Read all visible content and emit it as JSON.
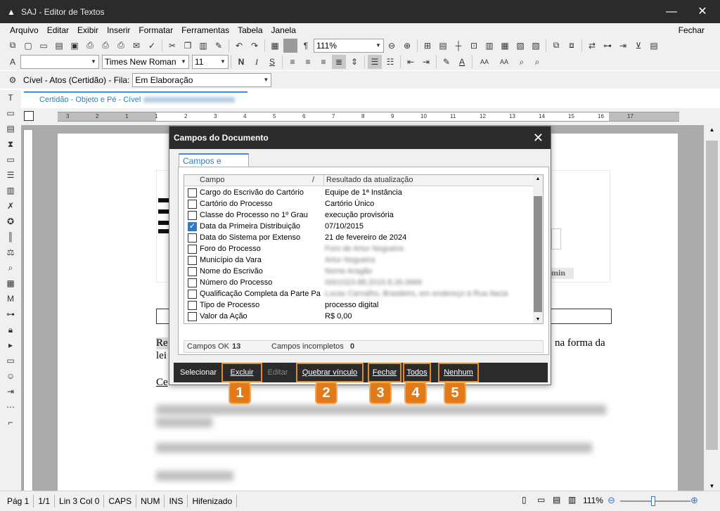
{
  "window": {
    "title": "SAJ - Editor de Textos",
    "minimize": "—",
    "close": "✕"
  },
  "menu": {
    "items": [
      "Arquivo",
      "Editar",
      "Exibir",
      "Inserir",
      "Formatar",
      "Ferramentas",
      "Tabela",
      "Janela"
    ],
    "fechar": "Fechar"
  },
  "toolbar1": {
    "zoom": "111%"
  },
  "toolbar2": {
    "font": "Times New Roman",
    "size": "11",
    "bold": "N",
    "italic": "I",
    "strike": "S",
    "fontsizeA1": "AA",
    "fontsizeA2": "AA"
  },
  "filter_bar": {
    "label": "Cível - Atos (Certidão) - Fila:",
    "value": "Em Elaboração"
  },
  "document_tab": {
    "label": "Certidão - Objeto e Pé - Cível"
  },
  "ruler": {
    "numbers": [
      "3",
      "2",
      "1",
      "1",
      "2",
      "3",
      "4",
      "5",
      "6",
      "7",
      "8",
      "9",
      "10",
      "11",
      "12",
      "13",
      "14",
      "15",
      "16",
      "17"
    ]
  },
  "page": {
    "text1": "Re",
    "text2": "lei",
    "text3": "Ce",
    "text4": "na forma da",
    "stamp": "min"
  },
  "dialog": {
    "title": "Campos do Documento",
    "tab": "Campos e valores",
    "headers": {
      "campo": "Campo",
      "sort": "/",
      "resultado": "Resultado da atualização"
    },
    "rows": [
      {
        "campo": "Cargo do Escrivão do Cartório",
        "valor": "Equipe de 1ª Instância",
        "checked": false,
        "blurred": false
      },
      {
        "campo": "Cartório do Processo",
        "valor": "Cartório Único",
        "checked": false,
        "blurred": false
      },
      {
        "campo": "Classe do Processo no 1º Grau",
        "valor": "execução provisória",
        "checked": false,
        "blurred": false
      },
      {
        "campo": "Data da Primeira Distribuição",
        "valor": "07/10/2015",
        "checked": true,
        "blurred": false
      },
      {
        "campo": "Data do Sistema por Extenso",
        "valor": "21 de fevereiro de 2024",
        "checked": false,
        "blurred": false
      },
      {
        "campo": "Foro do Processo",
        "valor": "Foro de Artur Nogueira",
        "checked": false,
        "blurred": true
      },
      {
        "campo": "Município da Vara",
        "valor": "Artur Nogueira",
        "checked": false,
        "blurred": true
      },
      {
        "campo": "Nome do Escrivão",
        "valor": "Nome Aragão",
        "checked": false,
        "blurred": true
      },
      {
        "campo": "Número do Processo",
        "valor": "0001023-88.2015.8.26.0666",
        "checked": false,
        "blurred": true
      },
      {
        "campo": "Qualificação Completa da Parte Pa",
        "valor": "Lucas Carvalho, Brasileiro, em endereço à Rua Itacia",
        "checked": false,
        "blurred": true
      },
      {
        "campo": "Tipo de Processo",
        "valor": "processo digital",
        "checked": false,
        "blurred": false
      },
      {
        "campo": "Valor da Ação",
        "valor": "R$ 0,00",
        "checked": false,
        "blurred": false
      }
    ],
    "summary": {
      "ok_label": "Campos OK",
      "ok_value": "13",
      "incomplete_label": "Campos incompletos",
      "incomplete_value": "0"
    },
    "buttons": {
      "selecionar": "Selecionar",
      "excluir": "Excluir",
      "editar": "Editar",
      "quebrar": "Quebrar vínculo",
      "fechar": "Fechar",
      "todos": "Todos",
      "nenhum": "Nenhum"
    }
  },
  "badges": [
    "1",
    "2",
    "3",
    "4",
    "5"
  ],
  "statusbar": {
    "page": "Pág 1",
    "pages": "1/1",
    "pos": "Lin 3  Col 0",
    "caps": "CAPS",
    "num": "NUM",
    "ins": "INS",
    "hif": "Hifenizado",
    "zoom": "111%"
  },
  "colors": {
    "accent": "#2f7bc4",
    "highlight": "#e27a1a",
    "titlebar": "#2b2b2b"
  }
}
